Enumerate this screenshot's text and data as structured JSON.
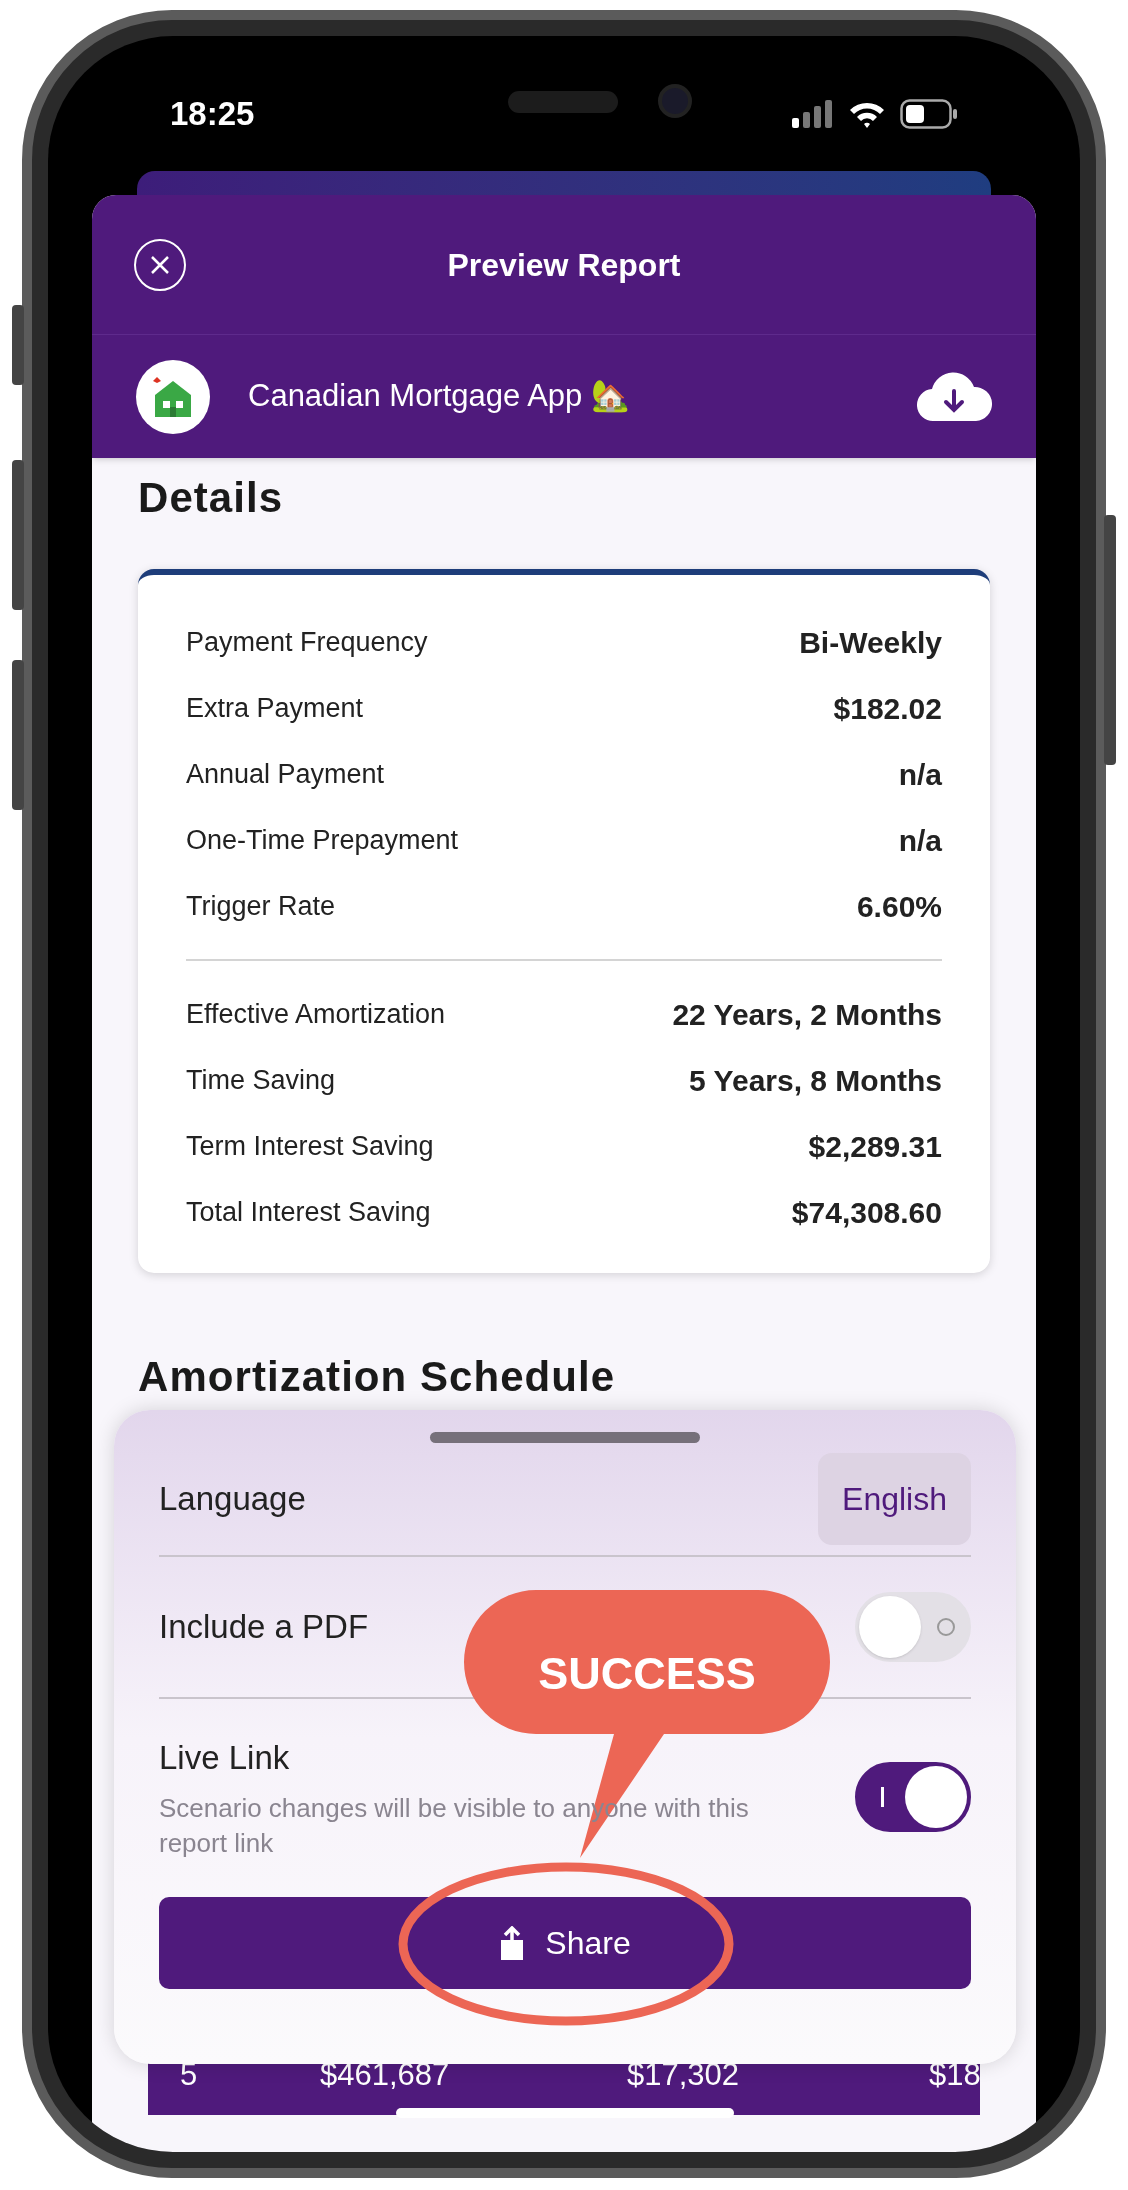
{
  "status_bar": {
    "time": "18:25"
  },
  "header": {
    "title": "Preview Report"
  },
  "app_bar": {
    "name": "Canadian Mortgage App 🏡"
  },
  "details": {
    "title": "Details",
    "groups": [
      [
        {
          "label": "Payment Frequency",
          "value": "Bi-Weekly"
        },
        {
          "label": "Extra Payment",
          "value": "$182.02"
        },
        {
          "label": "Annual Payment",
          "value": "n/a"
        },
        {
          "label": "One-Time Prepayment",
          "value": "n/a"
        },
        {
          "label": "Trigger Rate",
          "value": "6.60%"
        }
      ],
      [
        {
          "label": "Effective Amortization",
          "value": "22 Years, 2 Months"
        },
        {
          "label": "Time Saving",
          "value": "5 Years, 8 Months"
        },
        {
          "label": "Term Interest Saving",
          "value": "$2,289.31"
        },
        {
          "label": "Total Interest Saving",
          "value": "$74,308.60"
        }
      ]
    ]
  },
  "amortization": {
    "title": "Amortization Schedule",
    "visible_row": [
      "5",
      "$461,687",
      "$17,302",
      "$18"
    ]
  },
  "share_sheet": {
    "rows": [
      {
        "kind": "select",
        "label": "Language",
        "value": "English"
      },
      {
        "kind": "toggle",
        "label": "Include a PDF",
        "on": false
      },
      {
        "kind": "toggle",
        "label": "Live Link",
        "description": "Scenario changes will be visible to anyone with this report link",
        "on": true
      }
    ],
    "button": "Share"
  },
  "annotation": {
    "text": "SUCCESS"
  }
}
